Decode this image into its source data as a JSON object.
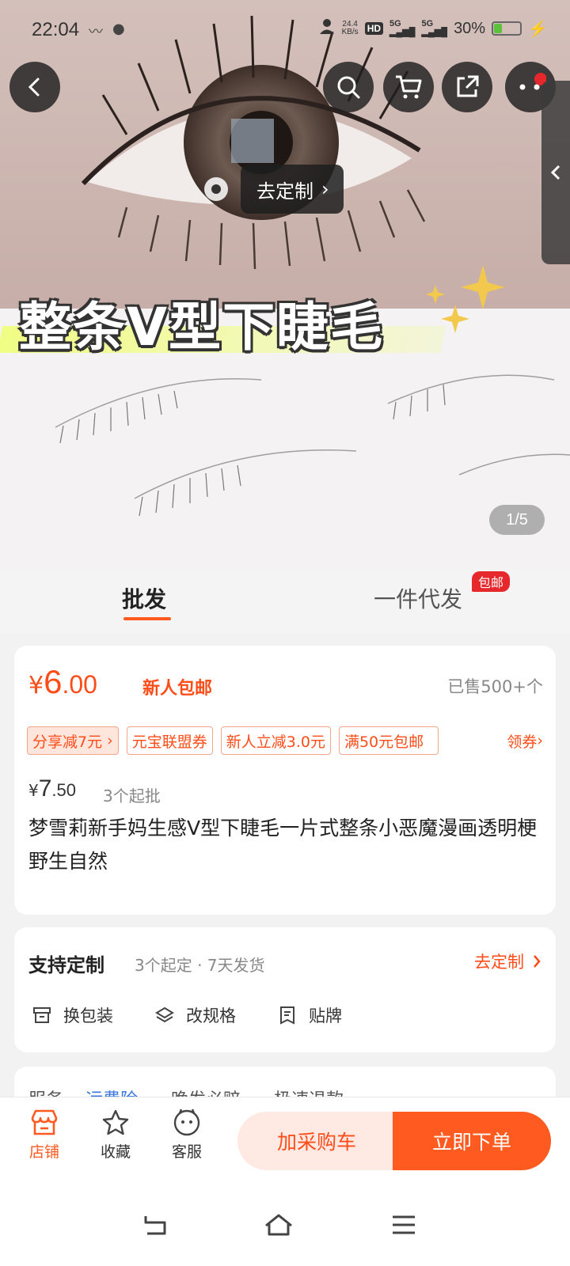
{
  "status_bar": {
    "time": "22:04",
    "net_speed_value": "24.4",
    "net_speed_unit": "KB/s",
    "hd_label": "HD",
    "signal_1": "5G",
    "signal_2": "5G",
    "battery": "30%",
    "battery_level": 0.3
  },
  "hero": {
    "customize_label": "去定制",
    "banner_text": "整条V型下睫毛",
    "image_counter": "1/5"
  },
  "tabs": {
    "wholesale": "批发",
    "dropship": "一件代发",
    "free_shipping_badge": "包邮"
  },
  "price": {
    "currency": "¥",
    "integer": "6",
    "decimal": ".00",
    "note": "新人包邮",
    "sold": "已售500+个",
    "coupons": [
      "分享减7元",
      "元宝联盟券",
      "新人立减3.0元",
      "满50元包邮"
    ],
    "get_coupon": "领券",
    "original_currency": "¥",
    "original_integer": "7",
    "original_decimal": ".50",
    "moq": "3个起批",
    "title": "梦雪莉新手妈生感V型下睫毛一片式整条小恶魔漫画透明梗野生自然"
  },
  "customization": {
    "title": "支持定制",
    "info": "3个起定 · 7天发货",
    "link": "去定制",
    "options": [
      "换包装",
      "改规格",
      "贴牌"
    ]
  },
  "service": {
    "label": "服务",
    "items": [
      "运费险",
      "晚发必赔",
      "极速退款"
    ]
  },
  "action_bar": {
    "store": "店铺",
    "favorite": "收藏",
    "service": "客服",
    "add_to_cart": "加采购车",
    "buy_now": "立即下单"
  },
  "colors": {
    "accent": "#ff5a1f",
    "price": "#ff4d1a",
    "badge": "#e6272b",
    "link_blue": "#3b76e1"
  }
}
